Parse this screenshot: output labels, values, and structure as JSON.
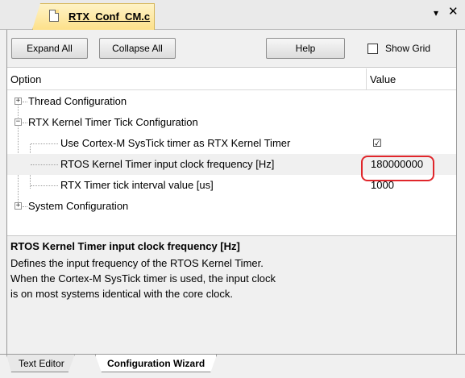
{
  "window": {
    "tab_title": "RTX_Conf_CM.c",
    "menu_glyph": "▾",
    "close_glyph": "✕"
  },
  "toolbar": {
    "expand_all": "Expand All",
    "collapse_all": "Collapse All",
    "help": "Help",
    "show_grid": "Show Grid",
    "show_grid_checked": false
  },
  "table": {
    "col_option": "Option",
    "col_value": "Value"
  },
  "tree": {
    "thread_config": {
      "label": "Thread Configuration",
      "expanded": false
    },
    "timer_tick": {
      "label": "RTX Kernel Timer Tick Configuration",
      "expanded": true,
      "children": {
        "use_systick": {
          "label": "Use Cortex-M SysTick timer as RTX Kernel Timer",
          "checked": true
        },
        "clock_freq": {
          "label": "RTOS Kernel Timer input clock frequency [Hz]",
          "value": "180000000"
        },
        "tick_interval": {
          "label": "RTX Timer tick interval value [us]",
          "value": "1000"
        }
      }
    },
    "system_config": {
      "label": "System Configuration",
      "expanded": false
    }
  },
  "description": {
    "title": "RTOS Kernel Timer input clock frequency [Hz]",
    "lines": [
      "Defines the input frequency of the RTOS Kernel Timer.",
      "When the Cortex-M SysTick timer is used, the input clock",
      "is on most systems identical with the core clock."
    ]
  },
  "bottom_tabs": {
    "text_editor": "Text Editor",
    "configuration_wizard": "Configuration Wizard"
  },
  "colors": {
    "highlight": "#e0262b",
    "tab_active": "#fde08a"
  }
}
